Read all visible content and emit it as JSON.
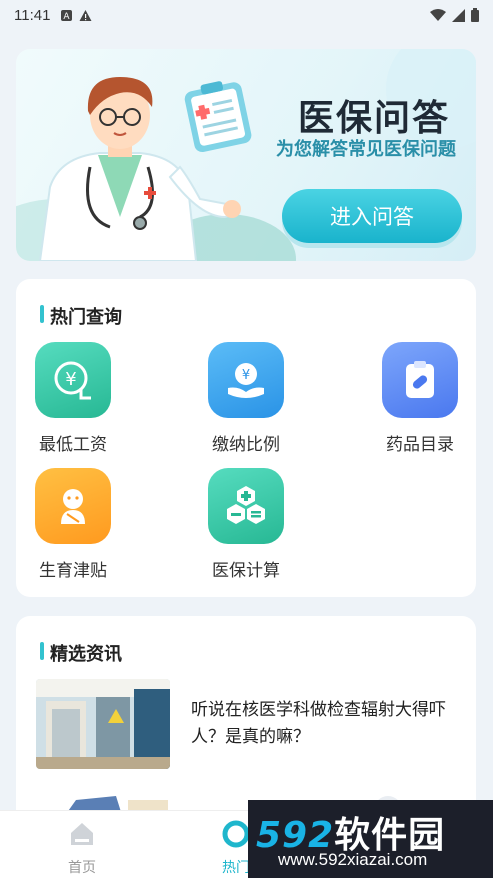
{
  "status": {
    "time": "11:41"
  },
  "banner": {
    "title": "医保问答",
    "subtitle": "为您解答常见医保问题",
    "button_label": "进入问答"
  },
  "hot": {
    "title": "热门查询",
    "items": [
      {
        "label": "最低工资",
        "icon": "yen-hand-icon",
        "color": "#3ccdb0"
      },
      {
        "label": "缴纳比例",
        "icon": "yen-palm-icon",
        "color": "#3aa7ef"
      },
      {
        "label": "药品目录",
        "icon": "pill-clipboard-icon",
        "color": "#5b8df5"
      },
      {
        "label": "生育津贴",
        "icon": "baby-icon",
        "color": "#ffa52a"
      },
      {
        "label": "医保计算",
        "icon": "calculator-hexagon-icon",
        "color": "#3ccdb0"
      }
    ]
  },
  "news": {
    "title": "精选资讯",
    "items": [
      {
        "title": "听说在核医学科做检查辐射大得吓人？是真的嘛？"
      }
    ]
  },
  "tabbar": {
    "tabs": [
      {
        "label": "首页",
        "icon": "home-icon",
        "active": false
      },
      {
        "label": "热门",
        "icon": "hot-icon",
        "active": true
      }
    ]
  },
  "watermark": {
    "brand_digits": "592",
    "brand_text": "软件园",
    "url": "www.592xiazai.com"
  }
}
